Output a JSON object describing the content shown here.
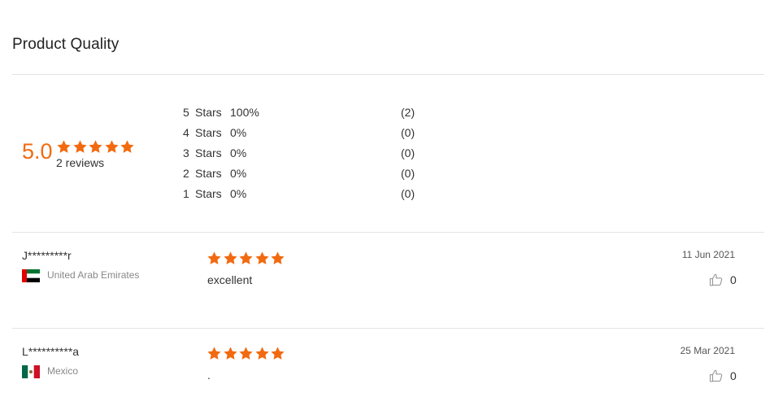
{
  "section": {
    "title": "Product Quality"
  },
  "colors": {
    "accent": "#f26a10",
    "divider": "#e3e3e3",
    "muted": "#888888"
  },
  "summary": {
    "score": "5.0",
    "rating": 5,
    "max_rating": 5,
    "reviews_label": "2 reviews"
  },
  "distribution": [
    {
      "stars": "5",
      "label": "Stars",
      "percent": "100%",
      "count": "(2)"
    },
    {
      "stars": "4",
      "label": "Stars",
      "percent": "0%",
      "count": "(0)"
    },
    {
      "stars": "3",
      "label": "Stars",
      "percent": "0%",
      "count": "(0)"
    },
    {
      "stars": "2",
      "label": "Stars",
      "percent": "0%",
      "count": "(0)"
    },
    {
      "stars": "1",
      "label": "Stars",
      "percent": "0%",
      "count": "(0)"
    }
  ],
  "reviews": [
    {
      "name": "J*********r",
      "country": "United Arab Emirates",
      "flag_icon": "uae-flag-icon",
      "rating": 5,
      "text": "excellent",
      "date": "11 Jun 2021",
      "helpful_icon": "thumbs-up-icon",
      "helpful_count": "0"
    },
    {
      "name": "L**********a",
      "country": "Mexico",
      "flag_icon": "mexico-flag-icon",
      "rating": 5,
      "text": ".",
      "date": "25 Mar 2021",
      "helpful_icon": "thumbs-up-icon",
      "helpful_count": "0"
    }
  ]
}
